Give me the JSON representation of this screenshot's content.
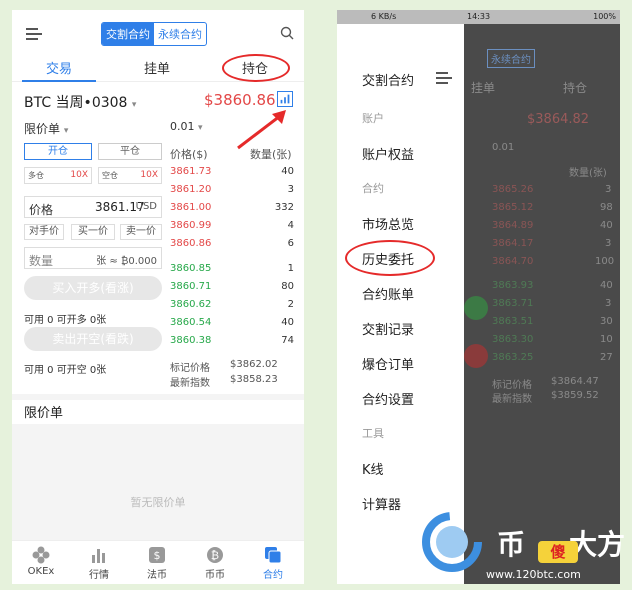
{
  "left": {
    "segment": [
      "交割合约",
      "永续合约"
    ],
    "tabs": [
      "交易",
      "挂单",
      "持仓"
    ],
    "instrument": "BTC 当周•0308",
    "price": "$3860.86",
    "order_type": "限价单",
    "depth": "0.01",
    "open_btn": "开仓",
    "close_btn": "平仓",
    "long_label": "多仓",
    "long_lev": "10X",
    "short_label": "空仓",
    "short_lev": "10X",
    "price_label": "价格",
    "price_value": "3861.17",
    "price_unit": "USD",
    "quick": [
      "对手价",
      "买一价",
      "卖一价"
    ],
    "qty_label": "数量",
    "qty_hint": "张 ≈ ₿0.000",
    "buy_btn": "买入开多(看涨)",
    "avail_long": "可用 0  可开多 0张",
    "sell_btn": "卖出开空(看跌)",
    "avail_short": "可用 0  可开空 0张",
    "ob_price_h": "价格($)",
    "ob_qty_h": "数量(张)",
    "asks": [
      {
        "p": "3861.73",
        "q": "40"
      },
      {
        "p": "3861.20",
        "q": "3"
      },
      {
        "p": "3861.00",
        "q": "332"
      },
      {
        "p": "3860.99",
        "q": "4"
      },
      {
        "p": "3860.86",
        "q": "6"
      }
    ],
    "bids": [
      {
        "p": "3860.85",
        "q": "1"
      },
      {
        "p": "3860.71",
        "q": "80"
      },
      {
        "p": "3860.62",
        "q": "2"
      },
      {
        "p": "3860.54",
        "q": "40"
      },
      {
        "p": "3860.38",
        "q": "74"
      }
    ],
    "mark_label": "标记价格",
    "mark_value": "$3862.02",
    "index_label": "最新指数",
    "index_value": "$3858.23",
    "limit_section": "限价单",
    "empty": "暂无限价单",
    "nav": [
      "OKEx",
      "行情",
      "法币",
      "币币",
      "合约"
    ]
  },
  "right": {
    "status_left": "6 KB/s",
    "status_time": "14:33",
    "status_battery": "100%",
    "bg": {
      "seg": "永续合约",
      "tab1": "挂单",
      "tab2": "持仓",
      "price": "$3864.82",
      "depth": "0.01",
      "qty_h": "数量(张)",
      "rows": [
        "3865.26",
        "3865.12",
        "3864.89",
        "3864.17",
        "3864.70",
        "3863.93",
        "3863.71",
        "3863.51",
        "3863.30",
        "3863.25"
      ],
      "qtys": [
        "3",
        "98",
        "40",
        "3",
        "100",
        "40",
        "3",
        "30",
        "10",
        "27"
      ],
      "mark_label": "标记价格",
      "mark_value": "$3864.47",
      "index_label": "最新指数",
      "index_value": "$3859.52"
    },
    "menu": {
      "title": "交割合约",
      "sec_account": "账户",
      "account_equity": "账户权益",
      "sec_contract": "合约",
      "market_overview": "市场总览",
      "history_orders": "历史委托",
      "contract_bill": "合约账单",
      "delivery_record": "交割记录",
      "liquidation_orders": "爆仓订单",
      "contract_settings": "合约设置",
      "sec_tools": "工具",
      "kline": "K线",
      "calculator": "计算器"
    }
  },
  "watermark": {
    "brand_1": "币",
    "brand_2": "傻",
    "brand_3": "大方",
    "url": "www.120btc.com"
  },
  "colors": {
    "accent": "#2f7fe8",
    "red": "#e34848",
    "green": "#27a84a",
    "highlight": "#e52a2a"
  }
}
